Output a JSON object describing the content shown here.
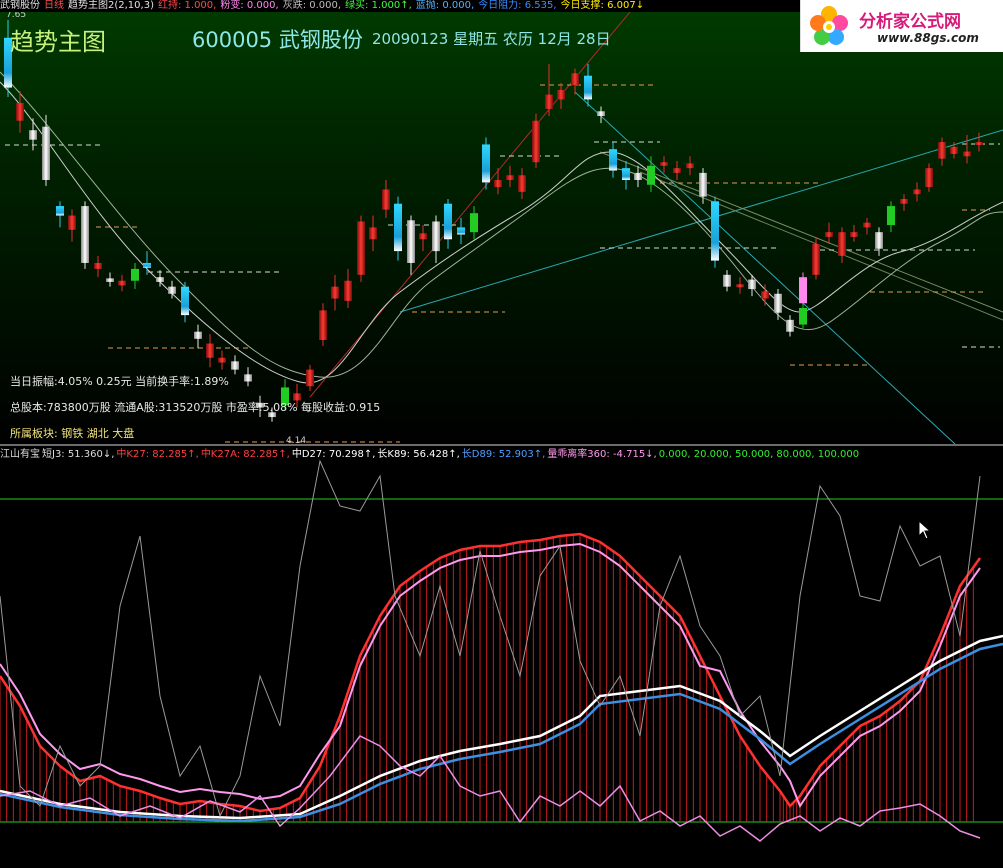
{
  "topbar": {
    "items": [
      {
        "text": "武钢股份",
        "color": "#e0e0e0"
      },
      {
        "text": "日线",
        "color": "#ff5050"
      },
      {
        "text": "趋势主图2(2,10,3)",
        "color": "#e0e0e0"
      },
      {
        "text": "红持: 1.000,",
        "color": "#ff4a4a"
      },
      {
        "text": "粉变: 0.000,",
        "color": "#ff88ee"
      },
      {
        "text": "灰跌: 0.000,",
        "color": "#bdbdbd"
      },
      {
        "text": "绿买: 1.000↑,",
        "color": "#3cff3c"
      },
      {
        "text": "蓝抛: 0.000,",
        "color": "#4fb4ff"
      },
      {
        "text": "今日阻力: 6.535,",
        "color": "#3c8cff"
      },
      {
        "text": "今日支撑: 6.007↓",
        "color": "#ffee00"
      }
    ],
    "price_tag": "7.65"
  },
  "main": {
    "title": "趋势主图",
    "stock": "600005 武钢股份",
    "date": "20090123 星期五 农历 12月 28日",
    "info_lines": [
      "当日振幅:4.05%  0.25元  当前换手率:1.89%",
      "总股本:783800万股 流通A股:313520万股 市盈率:5.08% 每股收益:0.915",
      "所属板块: 钢铁 湖北 大盘"
    ],
    "low_tag": "4.14"
  },
  "logo": {
    "name": "分析家公式网",
    "url": "www.88gs.com"
  },
  "sub": {
    "header": [
      {
        "text": "江山有宝",
        "color": "#dddddd"
      },
      {
        "text": "短J3: 51.360↓,",
        "color": "#dddddd"
      },
      {
        "text": "中K27: 82.285↑,",
        "color": "#ff4040"
      },
      {
        "text": "中K27A: 82.285↑,",
        "color": "#ff4040"
      },
      {
        "text": "中D27: 70.298↑,",
        "color": "#ffffff"
      },
      {
        "text": "长K89: 56.428↑,",
        "color": "#ffffff"
      },
      {
        "text": "长D89: 52.903↑,",
        "color": "#4f9fff"
      },
      {
        "text": "量乖离率360: -4.715↓,",
        "color": "#ff99ee"
      },
      {
        "text": "0.000, 20.000, 50.000, 80.000, 100.000",
        "color": "#33ee33"
      }
    ]
  },
  "colors": {
    "up": "#e8302a",
    "down_cyan": "#2ecbef",
    "down_white": "#e8e8e8",
    "green": "#22cc22",
    "pink": "#ff88ee"
  }
}
